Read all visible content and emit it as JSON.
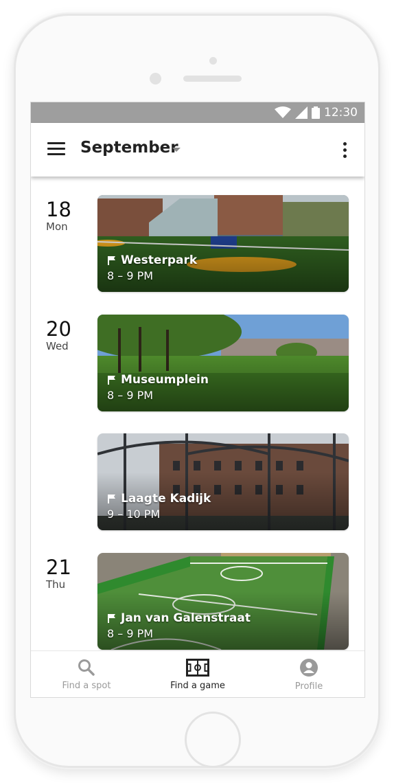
{
  "status_bar": {
    "time": "12:30"
  },
  "app_bar": {
    "title": "September"
  },
  "days": [
    {
      "day_num": "18",
      "day_name": "Mon"
    },
    {
      "day_num": "20",
      "day_name": "Wed"
    },
    {
      "day_num": "21",
      "day_name": "Thu"
    }
  ],
  "games": [
    {
      "location": "Westerpark",
      "time": "8 – 9 PM"
    },
    {
      "location": "Museumplein",
      "time": "8 – 9 PM"
    },
    {
      "location": "Laagte Kadijk",
      "time": "9 – 10 PM"
    },
    {
      "location": "Jan van Galenstraat",
      "time": "8 – 9 PM"
    }
  ],
  "bottom_nav": {
    "items": [
      {
        "label": "Find a spot",
        "icon": "search-icon",
        "active": false
      },
      {
        "label": "Find a game",
        "icon": "field-icon",
        "active": true
      },
      {
        "label": "Profile",
        "icon": "profile-icon",
        "active": false
      }
    ]
  },
  "colors": {
    "status_bar": "#9e9e9e",
    "active_nav": "#222222",
    "inactive_nav": "#9a9a9a"
  }
}
